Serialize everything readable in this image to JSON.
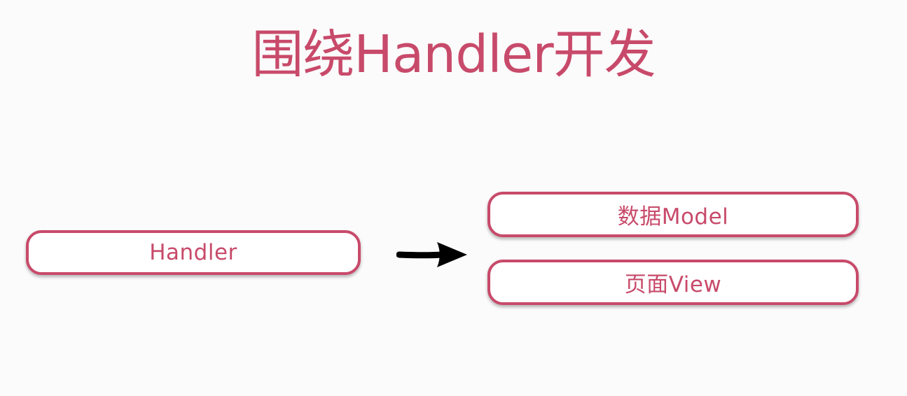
{
  "slide": {
    "title": "围绕Handler开发"
  },
  "diagram": {
    "source_box": {
      "label": "Handler"
    },
    "target_boxes": [
      {
        "label": "数据Model"
      },
      {
        "label": "页面View"
      }
    ]
  },
  "colors": {
    "accent": "#c84a6a",
    "arrow": "#000000",
    "background": "#fbfbfb"
  },
  "icons": {
    "connector": "right-arrow-icon"
  }
}
